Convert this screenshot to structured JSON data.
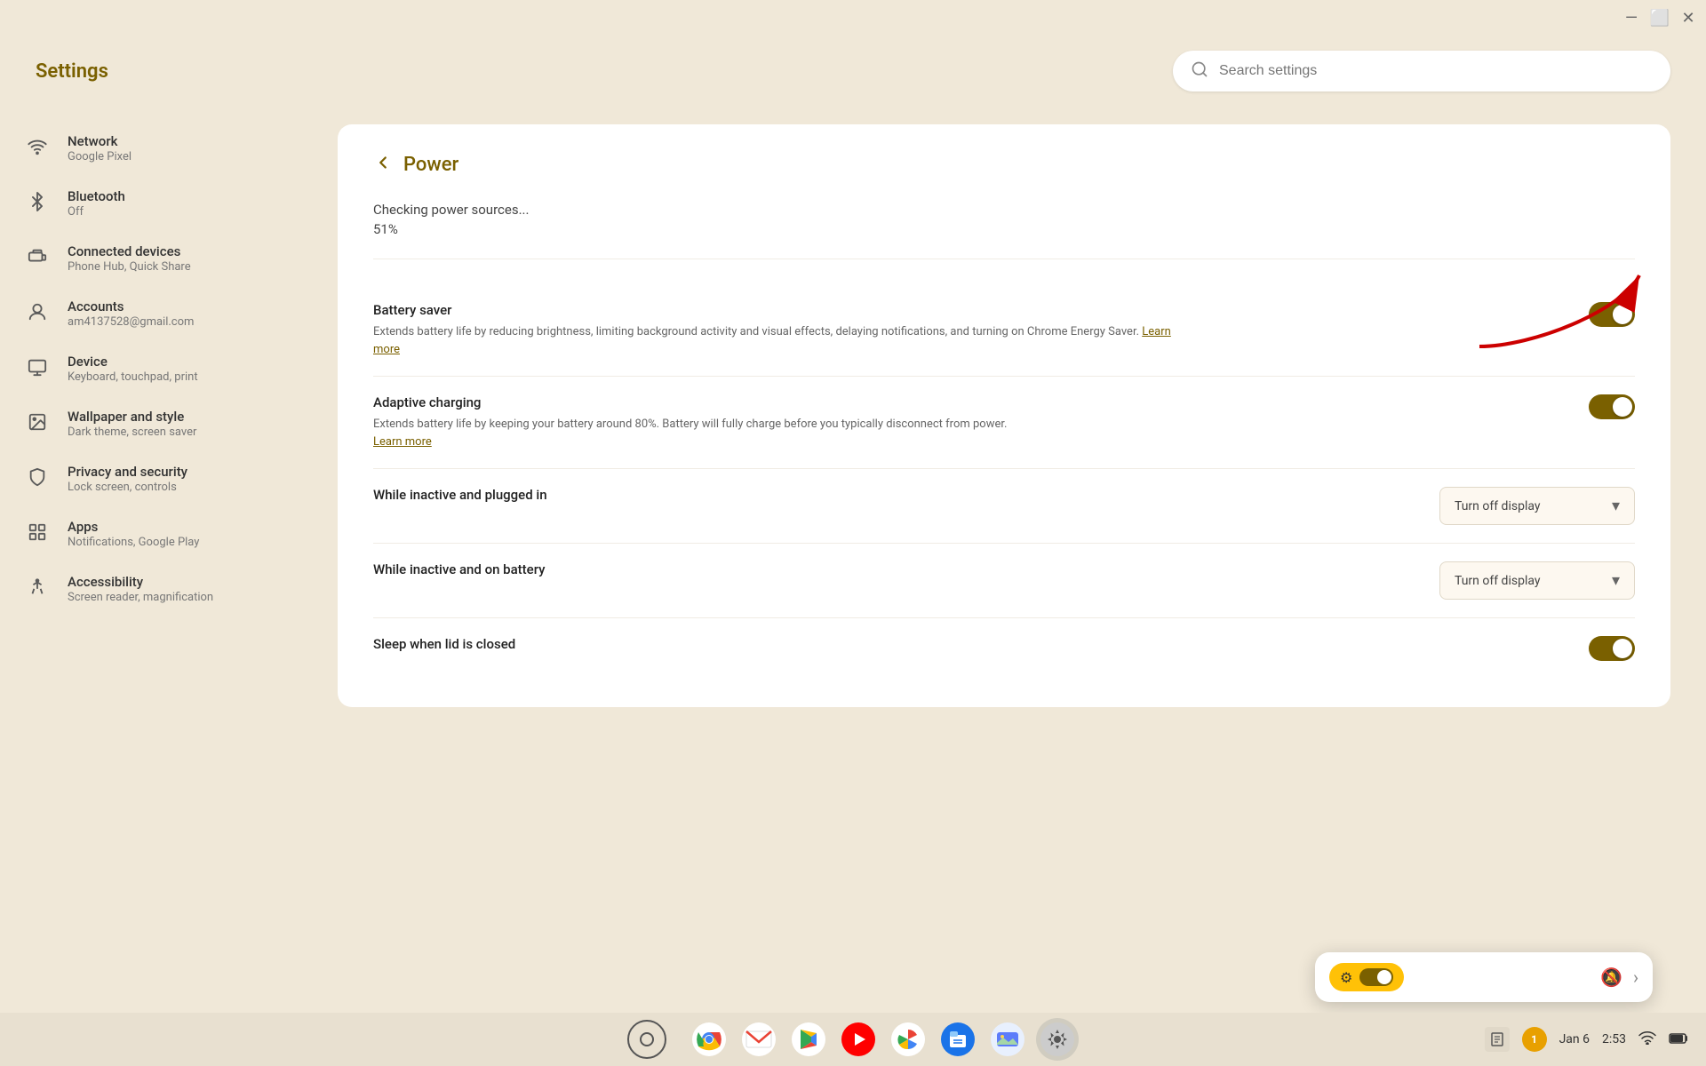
{
  "app": {
    "title": "Settings",
    "search_placeholder": "Search settings"
  },
  "titlebar": {
    "minimize": "—",
    "maximize": "⬜",
    "close": "✕"
  },
  "sidebar": {
    "items": [
      {
        "id": "network",
        "icon": "wifi",
        "label": "Network",
        "sublabel": "Google Pixel"
      },
      {
        "id": "bluetooth",
        "icon": "bluetooth",
        "label": "Bluetooth",
        "sublabel": "Off"
      },
      {
        "id": "connected-devices",
        "icon": "devices",
        "label": "Connected devices",
        "sublabel": "Phone Hub, Quick Share"
      },
      {
        "id": "accounts",
        "icon": "account",
        "label": "Accounts",
        "sublabel": "am4137528@gmail.com"
      },
      {
        "id": "device",
        "icon": "device",
        "label": "Device",
        "sublabel": "Keyboard, touchpad, print"
      },
      {
        "id": "wallpaper",
        "icon": "wallpaper",
        "label": "Wallpaper and style",
        "sublabel": "Dark theme, screen saver"
      },
      {
        "id": "privacy",
        "icon": "privacy",
        "label": "Privacy and security",
        "sublabel": "Lock screen, controls"
      },
      {
        "id": "apps",
        "icon": "apps",
        "label": "Apps",
        "sublabel": "Notifications, Google Play"
      },
      {
        "id": "accessibility",
        "icon": "accessibility",
        "label": "Accessibility",
        "sublabel": "Screen reader, magnification"
      }
    ]
  },
  "page": {
    "back_label": "←",
    "title": "Power"
  },
  "power": {
    "source_label": "Checking power sources...",
    "source_percent": "51%",
    "battery_saver": {
      "title": "Battery saver",
      "desc": "Extends battery life by reducing brightness, limiting background activity and visual effects, delaying notifications, and turning on Chrome Energy Saver.",
      "learn_more": "Learn more",
      "enabled": true
    },
    "adaptive_charging": {
      "title": "Adaptive charging",
      "desc": "Extends battery life by keeping your battery around 80%. Battery will fully charge before you typically disconnect from power.",
      "learn_more": "Learn more",
      "enabled": true
    },
    "inactive_plugged": {
      "label": "While inactive and plugged in",
      "value": "Turn off display"
    },
    "inactive_battery": {
      "label": "While inactive and on battery",
      "value": "Turn off display"
    },
    "sleep_lid": {
      "label": "Sleep when lid is closed",
      "enabled": true
    }
  },
  "taskbar": {
    "apps": [
      {
        "id": "chrome",
        "label": "Chrome"
      },
      {
        "id": "gmail",
        "label": "Gmail"
      },
      {
        "id": "play",
        "label": "Play"
      },
      {
        "id": "youtube",
        "label": "YouTube"
      },
      {
        "id": "photos",
        "label": "Photos"
      },
      {
        "id": "files",
        "label": "Files"
      },
      {
        "id": "gallery",
        "label": "Gallery"
      },
      {
        "id": "settings",
        "label": "Settings"
      }
    ]
  },
  "tray": {
    "date": "Jan 6",
    "time": "2:53",
    "wifi_icon": "wifi",
    "battery_icon": "battery"
  },
  "notification_popup": {
    "visible": true
  }
}
